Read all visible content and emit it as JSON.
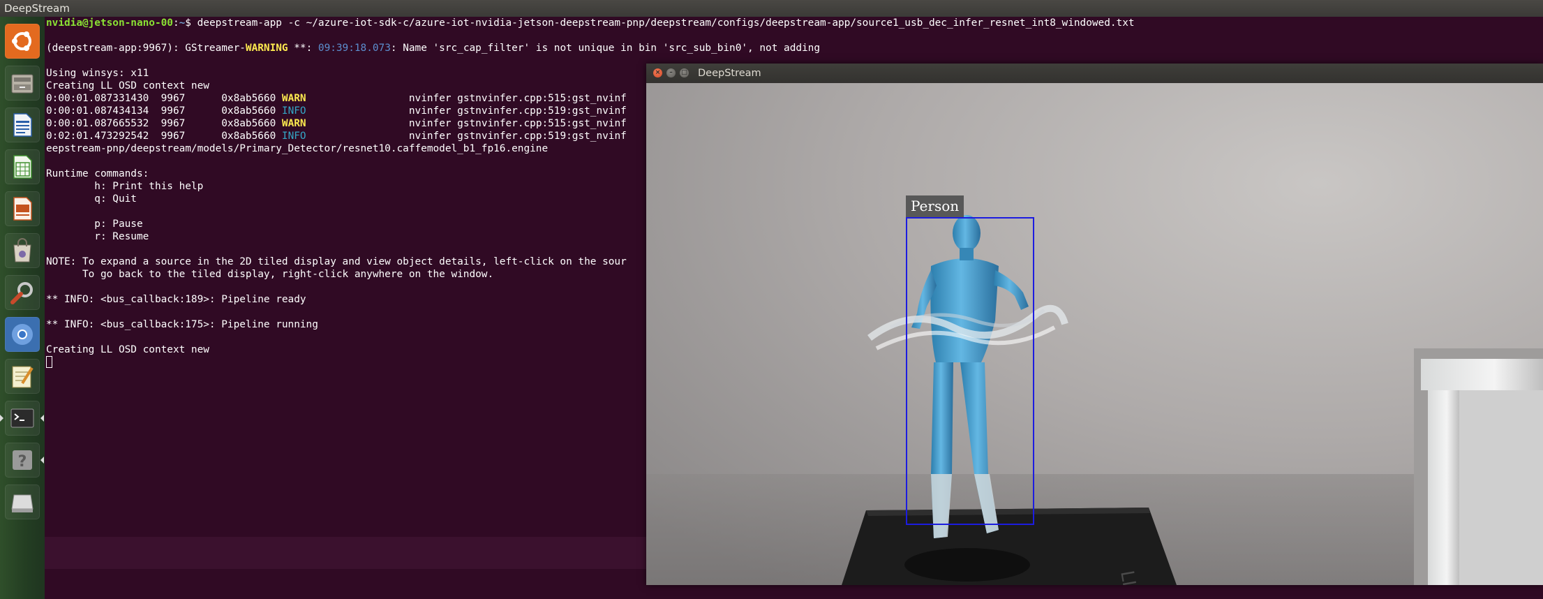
{
  "top_bar": {
    "title": "DeepStream"
  },
  "launcher": {
    "items": [
      {
        "name": "ubuntu-dash",
        "icon": "ubuntu-logo-icon"
      },
      {
        "name": "files",
        "icon": "files-icon"
      },
      {
        "name": "writer",
        "icon": "libreoffice-writer-icon"
      },
      {
        "name": "calc",
        "icon": "libreoffice-calc-icon"
      },
      {
        "name": "impress",
        "icon": "libreoffice-impress-icon"
      },
      {
        "name": "software",
        "icon": "shopping-bag-icon"
      },
      {
        "name": "settings",
        "icon": "system-settings-icon"
      },
      {
        "name": "chromium",
        "icon": "chromium-icon"
      },
      {
        "name": "text-editor",
        "icon": "text-editor-icon"
      },
      {
        "name": "terminal",
        "icon": "terminal-icon"
      },
      {
        "name": "help",
        "icon": "help-icon"
      },
      {
        "name": "drive",
        "icon": "drive-icon"
      }
    ]
  },
  "terminal": {
    "prompt_user": "nvidia@jetson-nano-00",
    "prompt_sep": ":",
    "prompt_path": "~",
    "prompt_end": "$ ",
    "command": "deepstream-app -c ~/azure-iot-sdk-c/azure-iot-nvidia-jetson-deepstream-pnp/deepstream/configs/deepstream-app/source1_usb_dec_infer_resnet_int8_windowed.txt",
    "warn_line": {
      "prefix": "(deepstream-app:9967): GStreamer-",
      "level": "WARNING",
      "mid": " **: ",
      "timestamp": "09:39:18.073",
      "message": ": Name 'src_cap_filter' is not unique in bin 'src_sub_bin0', not adding"
    },
    "winsys": "Using winsys: x11",
    "osd_context": "Creating LL OSD context new",
    "log_rows": [
      {
        "time": "0:00:01.087331430",
        "pid": "9967",
        "addr": "0x8ab5660",
        "level": "WARN",
        "src": "nvinfer gstnvinfer.cpp:515:gst_nvinf"
      },
      {
        "time": "0:00:01.087434134",
        "pid": "9967",
        "addr": "0x8ab5660",
        "level": "INFO",
        "src": "nvinfer gstnvinfer.cpp:519:gst_nvinf"
      },
      {
        "time": "0:00:01.087665532",
        "pid": "9967",
        "addr": "0x8ab5660",
        "level": "WARN",
        "src": "nvinfer gstnvinfer.cpp:515:gst_nvinf"
      },
      {
        "time": "0:02:01.473292542",
        "pid": "9967",
        "addr": "0x8ab5660",
        "level": "INFO",
        "src": "nvinfer gstnvinfer.cpp:519:gst_nvinf"
      }
    ],
    "engine_path": "eepstream-pnp/deepstream/models/Primary_Detector/resnet10.caffemodel_b1_fp16.engine",
    "runtime_header": "Runtime commands:",
    "help_cmd": "        h: Print this help",
    "quit_cmd": "        q: Quit",
    "pause_cmd": "        p: Pause",
    "resume_cmd": "        r: Resume",
    "note_line1": "NOTE: To expand a source in the 2D tiled display and view object details, left-click on the sour",
    "note_line2": "      To go back to the tiled display, right-click anywhere on the window.",
    "pipeline_ready": "** INFO: <bus_callback:189>: Pipeline ready",
    "pipeline_running": "** INFO: <bus_callback:175>: Pipeline running",
    "osd_context2": "Creating LL OSD context new"
  },
  "deepstream_window": {
    "title": "DeepStream",
    "detection_label": "Person",
    "bbox_color": "#1c1ce0"
  },
  "colors": {
    "terminal_bg": "#300a24",
    "prompt_green": "#8ae234",
    "prompt_blue": "#729fcf",
    "warn_yellow": "#fce94f",
    "info_cyan": "#34a7c6"
  }
}
